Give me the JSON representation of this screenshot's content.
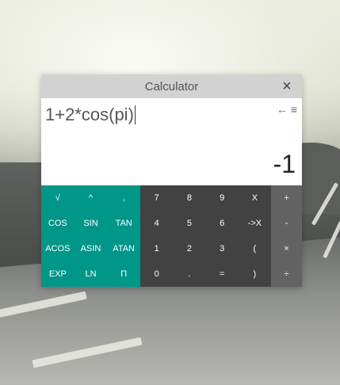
{
  "window": {
    "title": "Calculator",
    "close_icon": "×"
  },
  "display": {
    "expression": "1+2*cos(pi)",
    "result": "-1",
    "backspace_icon": "←",
    "menu_icon": "≡"
  },
  "keypad": {
    "functions": [
      "√",
      "^",
      ",",
      "COS",
      "SIN",
      "TAN",
      "ACOS",
      "ASIN",
      "ATAN",
      "EXP",
      "LN",
      "Π"
    ],
    "numbers": [
      "7",
      "8",
      "9",
      "X",
      "4",
      "5",
      "6",
      "->X",
      "1",
      "2",
      "3",
      "(",
      "0",
      ".",
      "=",
      ")"
    ],
    "operators": [
      "+",
      "-",
      "×",
      "÷"
    ]
  },
  "colors": {
    "function_pad": "#009688",
    "number_pad": "#424242",
    "operator_pad": "#636363",
    "titlebar": "#d2d2d2"
  }
}
